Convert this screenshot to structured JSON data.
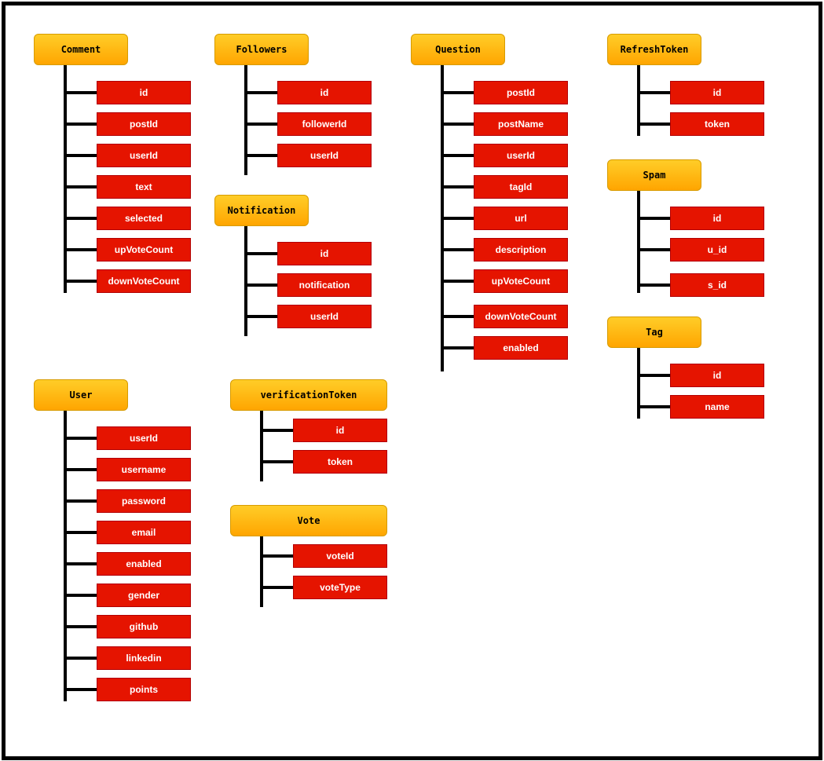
{
  "entities": [
    {
      "name": "Comment",
      "fields": [
        "id",
        "postId",
        "userId",
        "text",
        "selected",
        "upVoteCount",
        "downVoteCount"
      ]
    },
    {
      "name": "Followers",
      "fields": [
        "id",
        "followerId",
        "userId"
      ]
    },
    {
      "name": "Notification",
      "fields": [
        "id",
        "notification",
        "userId"
      ]
    },
    {
      "name": "Question",
      "fields": [
        "postId",
        "postName",
        "userId",
        "tagId",
        "url",
        "description",
        "upVoteCount",
        "downVoteCount",
        "enabled"
      ]
    },
    {
      "name": "RefreshToken",
      "fields": [
        "id",
        "token"
      ]
    },
    {
      "name": "Spam",
      "fields": [
        "id",
        "u_id",
        "s_id"
      ]
    },
    {
      "name": "Tag",
      "fields": [
        "id",
        "name"
      ]
    },
    {
      "name": "User",
      "fields": [
        "userId",
        "username",
        "password",
        "email",
        "enabled",
        "gender",
        "github",
        "linkedin",
        "points"
      ]
    },
    {
      "name": "verificationToken",
      "fields": [
        "id",
        "token"
      ]
    },
    {
      "name": "Vote",
      "fields": [
        "voteId",
        "voteType"
      ]
    }
  ],
  "colors": {
    "header_fill": "#ffc000",
    "field_fill": "#e51400",
    "connector": "#000000"
  }
}
